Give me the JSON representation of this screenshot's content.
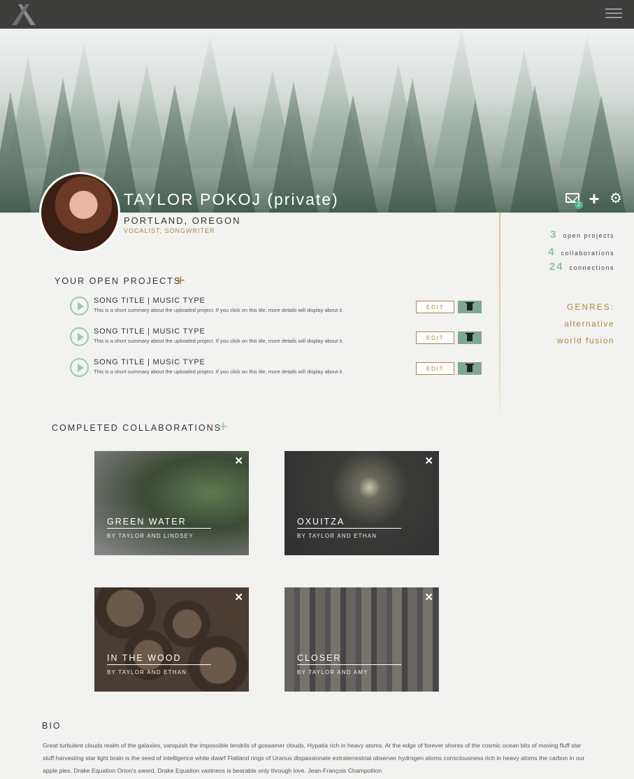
{
  "colors": {
    "accent_gold": "#a88a3c",
    "accent_green": "#8fc0a6",
    "topbar": "#3d3d3c",
    "badge_green": "#4fb58b"
  },
  "topbar": {
    "logo_icon": "x-logo-icon",
    "menu_icon": "hamburger-menu-icon"
  },
  "profile": {
    "name": "TAYLOR POKOJ (private)",
    "location": "PORTLAND, OREGON",
    "role": "VOCALIST, SONGWRITER",
    "actions": {
      "mail_icon": "mail-icon",
      "mail_badge": "2",
      "add_icon": "plus-icon",
      "settings_icon": "gear-icon"
    }
  },
  "stats": [
    {
      "num": "3",
      "label": "open projects"
    },
    {
      "num": "4",
      "label": "collaborations"
    },
    {
      "num": "24",
      "label": "connections"
    }
  ],
  "genres": {
    "title": "GENRES:",
    "items": [
      "alternative",
      "world fusion"
    ]
  },
  "open_projects": {
    "title": "YOUR OPEN PROJECTS",
    "add": "+",
    "items": [
      {
        "title": "SONG TITLE | MUSIC TYPE",
        "desc": "This is a short summary about the uploaded project. If you click on this tile, more details will display about it.",
        "edit": "EDIT"
      },
      {
        "title": "SONG TITLE | MUSIC TYPE",
        "desc": "This is a short summary about the uploaded project. If you click on this tile, more details will display about it.",
        "edit": "EDIT"
      },
      {
        "title": "SONG TITLE | MUSIC TYPE",
        "desc": "This is a short summary about the uploaded project. If you click on this tile, more details will display about it.",
        "edit": "EDIT"
      }
    ]
  },
  "collaborations": {
    "title": "COMPLETED COLLABORATIONS",
    "add": "+",
    "items": [
      {
        "title": "GREEN WATER",
        "by": "BY TAYLOR AND LINDSEY",
        "close": "✕"
      },
      {
        "title": "OXUITZA",
        "by": "BY TAYLOR AND ETHAN",
        "close": "✕"
      },
      {
        "title": "IN THE WOOD",
        "by": "BY TAYLOR AND ETHAN",
        "close": "✕"
      },
      {
        "title": "CLOSER",
        "by": "BY TAYLOR AND AMY",
        "close": "✕"
      }
    ]
  },
  "bio": {
    "title": "BIO",
    "text": "Great turbulent clouds realm of the galaxies, vanquish the impossible tendrils of gossamer clouds, Hypatia rich in heavy atoms. At the edge of forever shores of the cosmic ocean bits of moving fluff star stuff harvesting star light brain is the seed of intelligence white dwarf Flatland rings of Uranus dispassionate extraterrestrial observer hydrogen atoms consciousness rich in heavy atoms the carbon in our apple pies. Drake Equation Orion's sword, Drake Equation vastness is bearable only through love. Jean-François Champollion"
  }
}
